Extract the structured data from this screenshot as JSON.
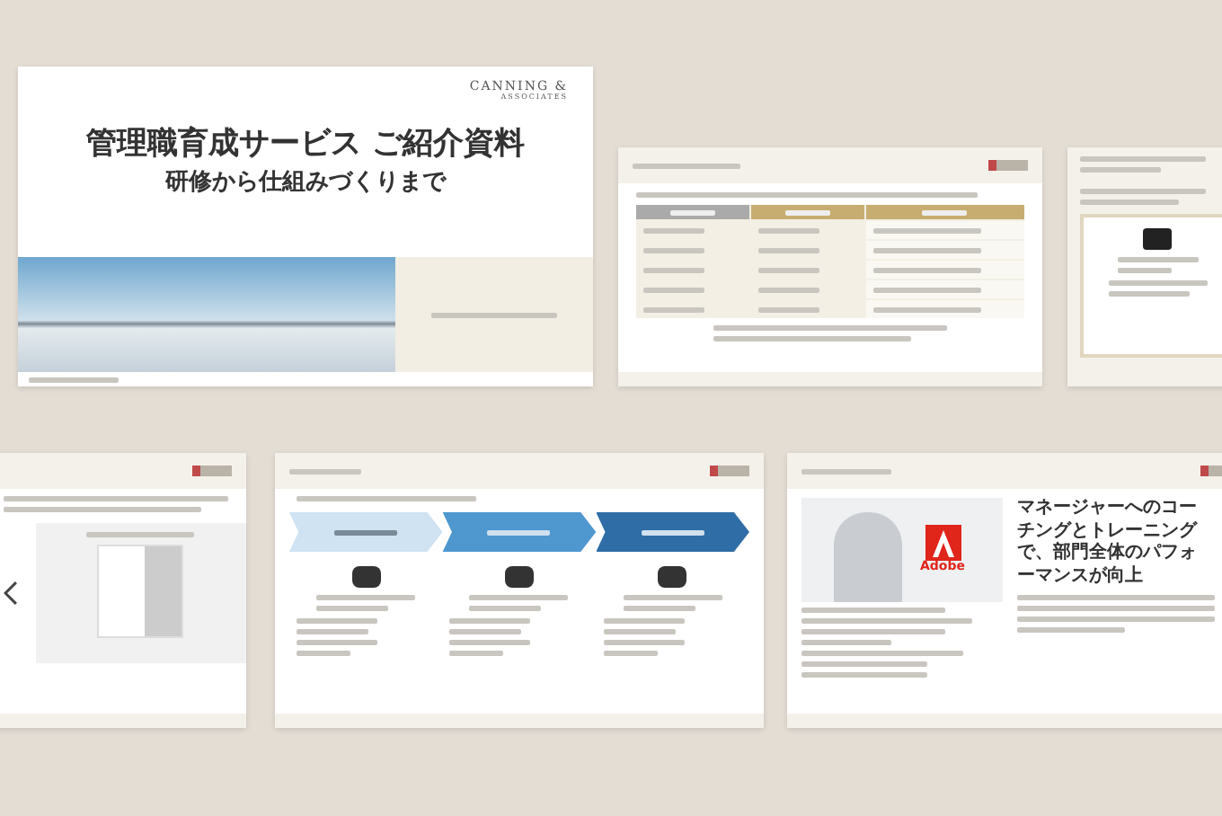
{
  "slides": [
    {
      "kind": "cover",
      "logo": "CANNING &",
      "logo_sub": "ASSOCIATES",
      "title": "管理職育成サービス ご紹介資料",
      "subtitle": "研修から仕組みづくりまで"
    },
    {
      "kind": "table"
    },
    {
      "kind": "card"
    },
    {
      "kind": "assessment"
    },
    {
      "kind": "flow"
    },
    {
      "kind": "case",
      "heading": "マネージャーへのコーチングとトレーニングで、部門全体のパフォーマンスが向上",
      "logo": "Adobe"
    }
  ]
}
